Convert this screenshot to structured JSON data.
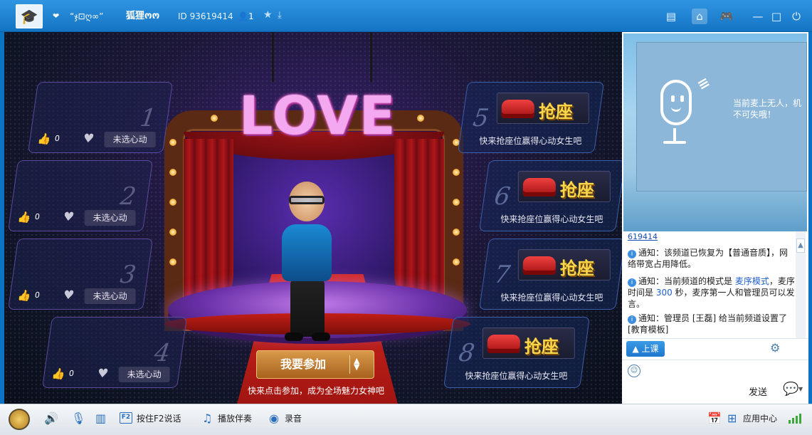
{
  "titlebar": {
    "heart": "❤",
    "nickname": "“ჯ⊡ღ∞”",
    "channel_name": "狐狸ოო",
    "channel_id": "ID 93619414",
    "user_count": "1",
    "icons": [
      "graduation-cap-icon",
      "star-icon",
      "download-icon",
      "list-icon",
      "home-icon",
      "gamepad-icon",
      "minimize-icon",
      "maximize-icon",
      "power-icon"
    ]
  },
  "stage": {
    "love_text": "LOVE",
    "left_seats": [
      {
        "num": "1",
        "likes": "0",
        "pick_label": "未选心动"
      },
      {
        "num": "2",
        "likes": "0",
        "pick_label": "未选心动"
      },
      {
        "num": "3",
        "likes": "0",
        "pick_label": "未选心动"
      },
      {
        "num": "4",
        "likes": "0",
        "pick_label": "未选心动"
      }
    ],
    "right_seats": [
      {
        "num": "5",
        "grab_label": "抢座",
        "hint": "快来抢座位赢得心动女生吧"
      },
      {
        "num": "6",
        "grab_label": "抢座",
        "hint": "快来抢座位赢得心动女生吧"
      },
      {
        "num": "7",
        "grab_label": "抢座",
        "hint": "快来抢座位赢得心动女生吧"
      },
      {
        "num": "8",
        "grab_label": "抢座",
        "hint": "快来抢座位赢得心动女生吧"
      }
    ],
    "join_button": "我要参加",
    "join_hint": "快来点击参加，成为全场魅力女神吧"
  },
  "video": {
    "note_line1": "当前麦上无人，机",
    "note_line2": "不可失哦！"
  },
  "chat": {
    "id_line": "619414",
    "messages": [
      {
        "prefix": "通知：",
        "text": "该频道已恢复为【普通音质】，网络带宽占用降低。"
      },
      {
        "prefix": "通知：",
        "text_a": "当前频道的模式是 ",
        "hl1": "麦序模式",
        "text_b": "，麦序时间是 ",
        "hl2": "300",
        "text_c": " 秒，麦序第一人和管理员可以发言。"
      },
      {
        "prefix": "通知：",
        "text": "管理员 [王磊] 给当前频道设置了[教育模板]"
      }
    ]
  },
  "chat_tools": {
    "class_button": "上课"
  },
  "input": {
    "send_label": "发送"
  },
  "bottombar": {
    "f2_key": "F2",
    "f2_label": "按住F2说话",
    "music_label": "播放伴奏",
    "record_label": "录音",
    "app_center": "应用中心"
  }
}
